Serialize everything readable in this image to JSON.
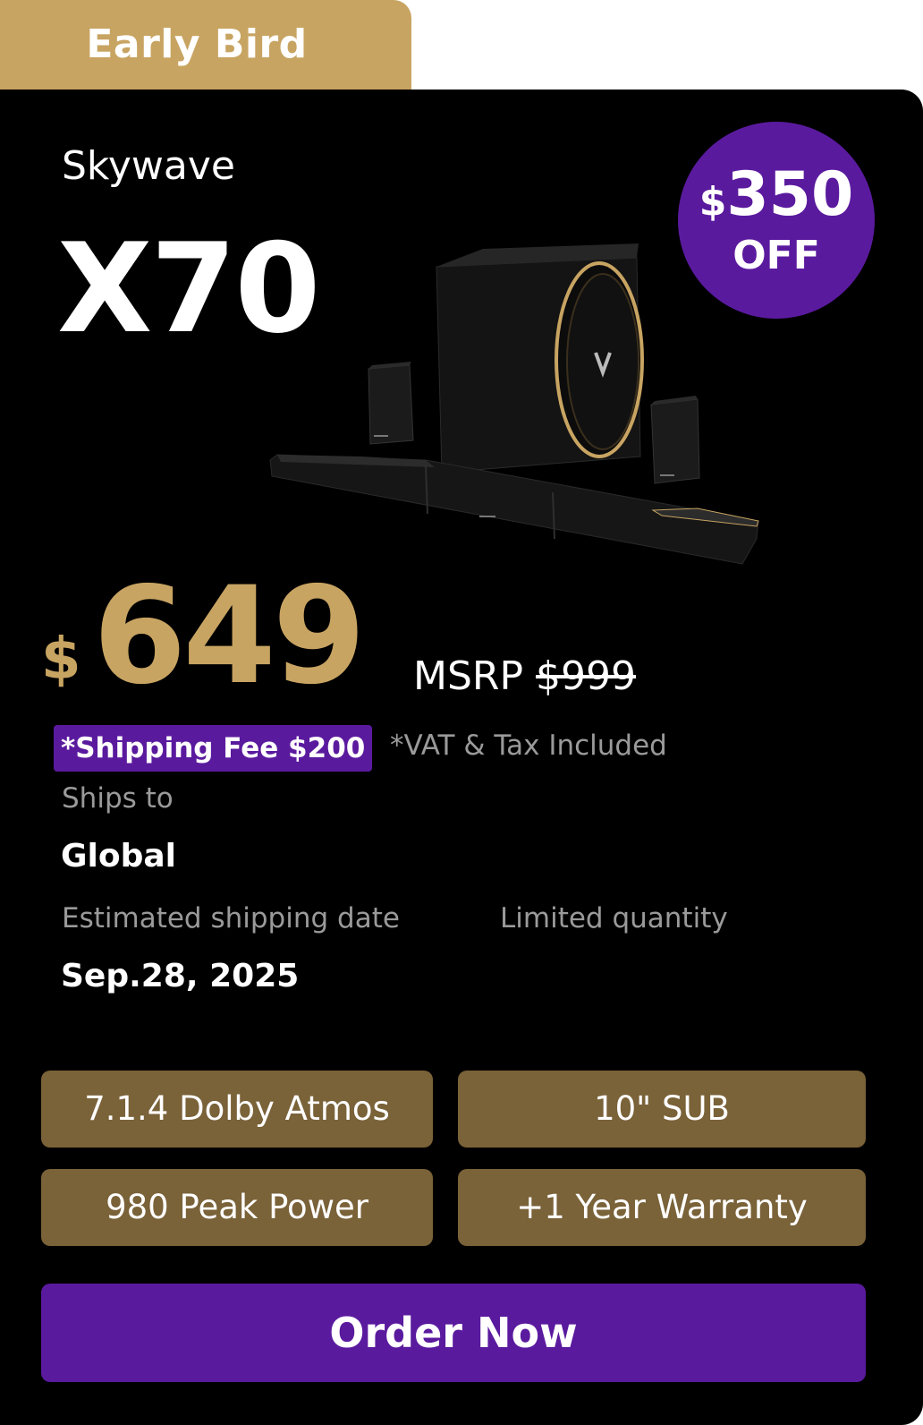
{
  "tab": {
    "label": "Early Bird"
  },
  "product": {
    "brand": "Skywave",
    "model": "X70"
  },
  "badge": {
    "currency": "$",
    "amount": "350",
    "suffix": "OFF"
  },
  "price": {
    "currency": "$",
    "value": "649",
    "msrp_label": "MSRP",
    "msrp_value": "$999"
  },
  "notes": {
    "shipping_fee": "*Shipping Fee $200",
    "vat": "*VAT & Tax Included"
  },
  "shipping": {
    "ships_to_label": "Ships to",
    "ships_to_value": "Global",
    "date_label": "Estimated shipping date",
    "date_value": "Sep.28, 2025",
    "quantity_label": "Limited quantity"
  },
  "features": [
    "7.1.4 Dolby Atmos",
    "10\" SUB",
    "980 Peak Power",
    "+1 Year Warranty"
  ],
  "cta": {
    "label": "Order Now"
  },
  "colors": {
    "gold": "#c8a462",
    "purple": "#5a1a9e",
    "feature_bg": "#7a6239",
    "card_bg": "#000000"
  }
}
